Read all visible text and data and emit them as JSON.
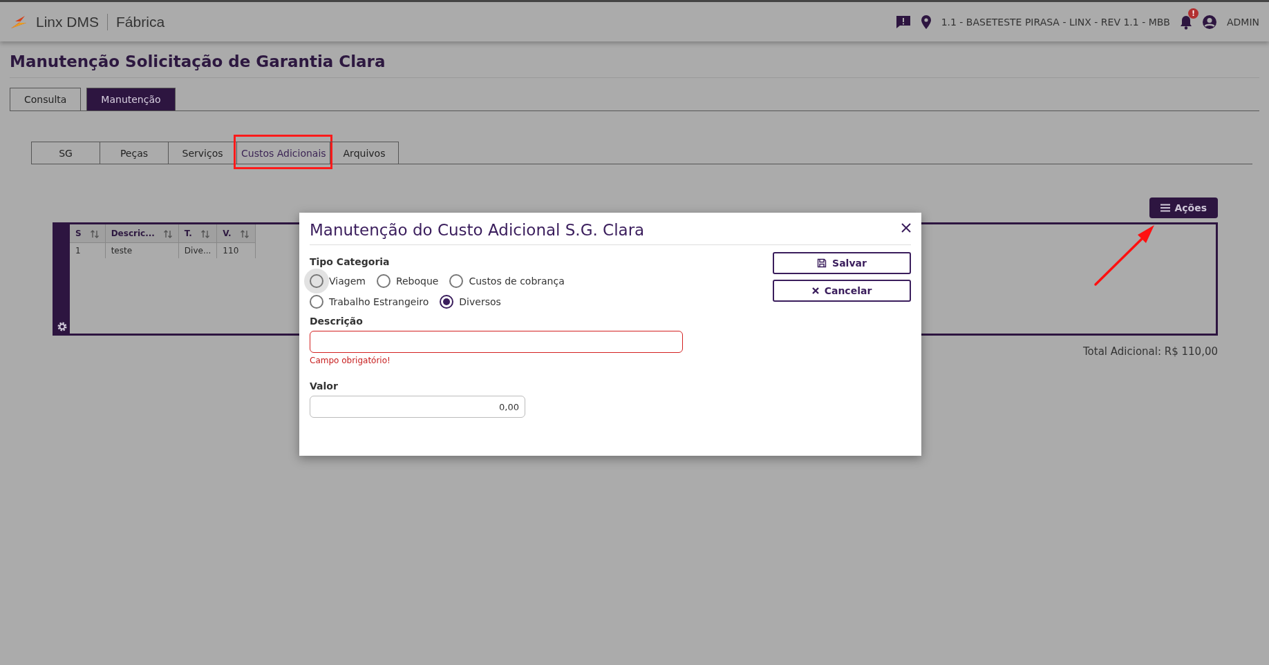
{
  "header": {
    "brand": "Linx DMS",
    "module": "Fábrica",
    "location": "1.1 - BASETESTE PIRASA - LINX - REV 1.1 - MBB",
    "notification_badge": "!",
    "user": "ADMIN"
  },
  "page_title": "Manutenção Solicitação de Garantia Clara",
  "tabs": [
    {
      "label": "Consulta",
      "selected": false
    },
    {
      "label": "Manutenção",
      "selected": true
    }
  ],
  "subtabs": [
    {
      "label": "SG",
      "selected": false,
      "highlighted": false
    },
    {
      "label": "Peças",
      "selected": false,
      "highlighted": false
    },
    {
      "label": "Serviços",
      "selected": false,
      "highlighted": false
    },
    {
      "label": "Custos Adicionais",
      "selected": true,
      "highlighted": true
    },
    {
      "label": "Arquivos",
      "selected": false,
      "highlighted": false
    }
  ],
  "actions_button": "Ações",
  "table": {
    "columns": [
      "S",
      "Descric...",
      "T.",
      "V."
    ],
    "rows": [
      [
        "1",
        "teste",
        "Dive...",
        "110"
      ]
    ]
  },
  "total": "Total Adicional: R$ 110,00",
  "modal": {
    "title": "Manutenção do Custo Adicional S.G. Clara",
    "category_label": "Tipo Categoria",
    "radio_rows": [
      [
        {
          "label": "Viagem",
          "selected": false,
          "focused": true
        },
        {
          "label": "Reboque",
          "selected": false,
          "focused": false
        },
        {
          "label": "Custos de cobrança",
          "selected": false,
          "focused": false
        }
      ],
      [
        {
          "label": "Trabalho Estrangeiro",
          "selected": false,
          "focused": false
        },
        {
          "label": "Diversos",
          "selected": true,
          "focused": false
        }
      ]
    ],
    "description_label": "Descrição",
    "description_invalid": true,
    "description_error": "Campo obrigatório!",
    "value_label": "Valor",
    "value": "0,00",
    "buttons": [
      {
        "kind": "save",
        "label": "Salvar"
      },
      {
        "kind": "cancel",
        "label": "Cancelar"
      }
    ]
  }
}
